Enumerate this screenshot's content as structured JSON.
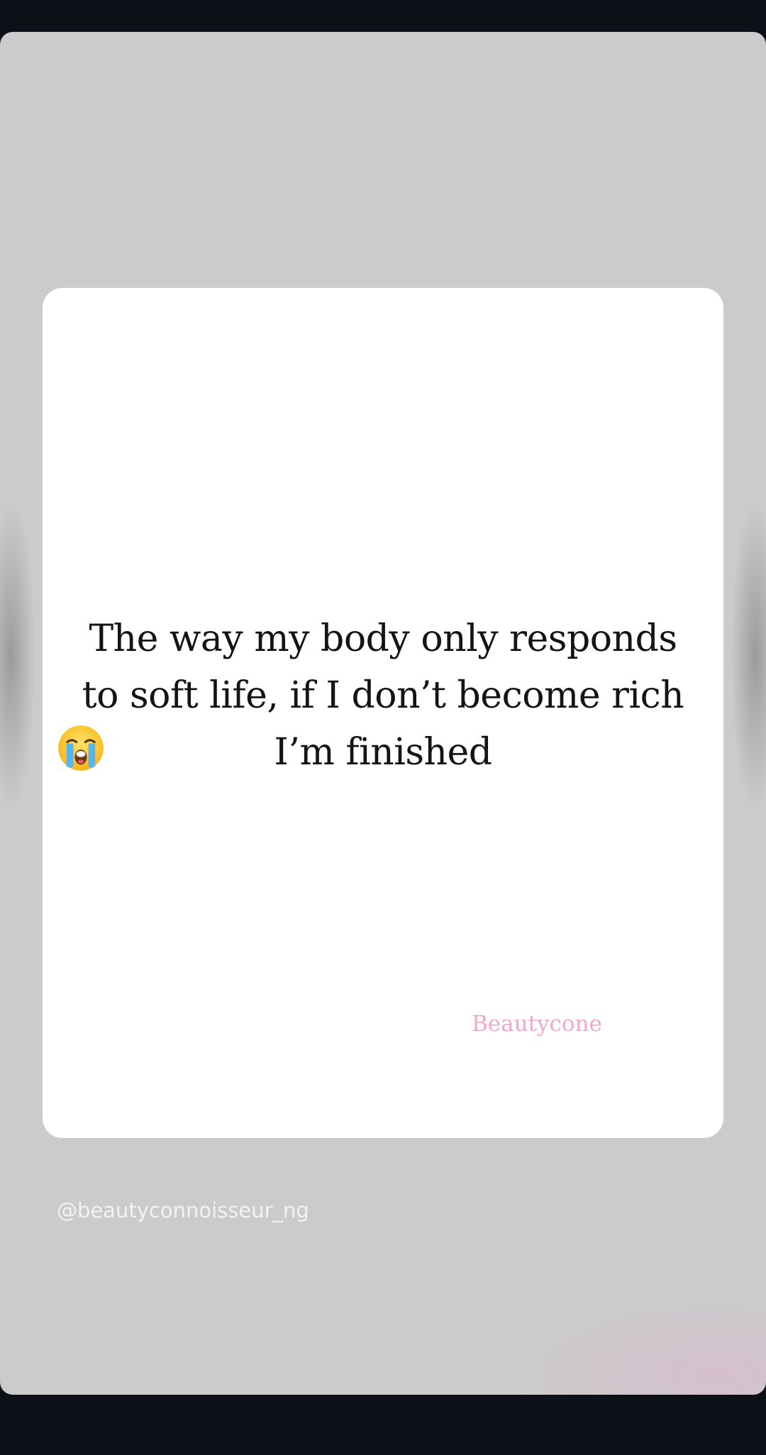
{
  "story": {
    "post": {
      "quote_line_1": "The way my body only responds",
      "quote_line_2": "to soft life, if I don’t become rich",
      "quote_line_3": "I’m finished",
      "emoji_icon": "loudly-crying-face-icon",
      "watermark": "Beautycone"
    },
    "attribution_handle": "@beautyconnoisseur_ng"
  },
  "colors": {
    "screen_background": "#0d1117",
    "story_background": "#cbcbcb",
    "card_background": "#ffffff",
    "quote_text": "#141414",
    "watermark_text": "#f0a9c8",
    "handle_text": "#f2f2f2"
  }
}
